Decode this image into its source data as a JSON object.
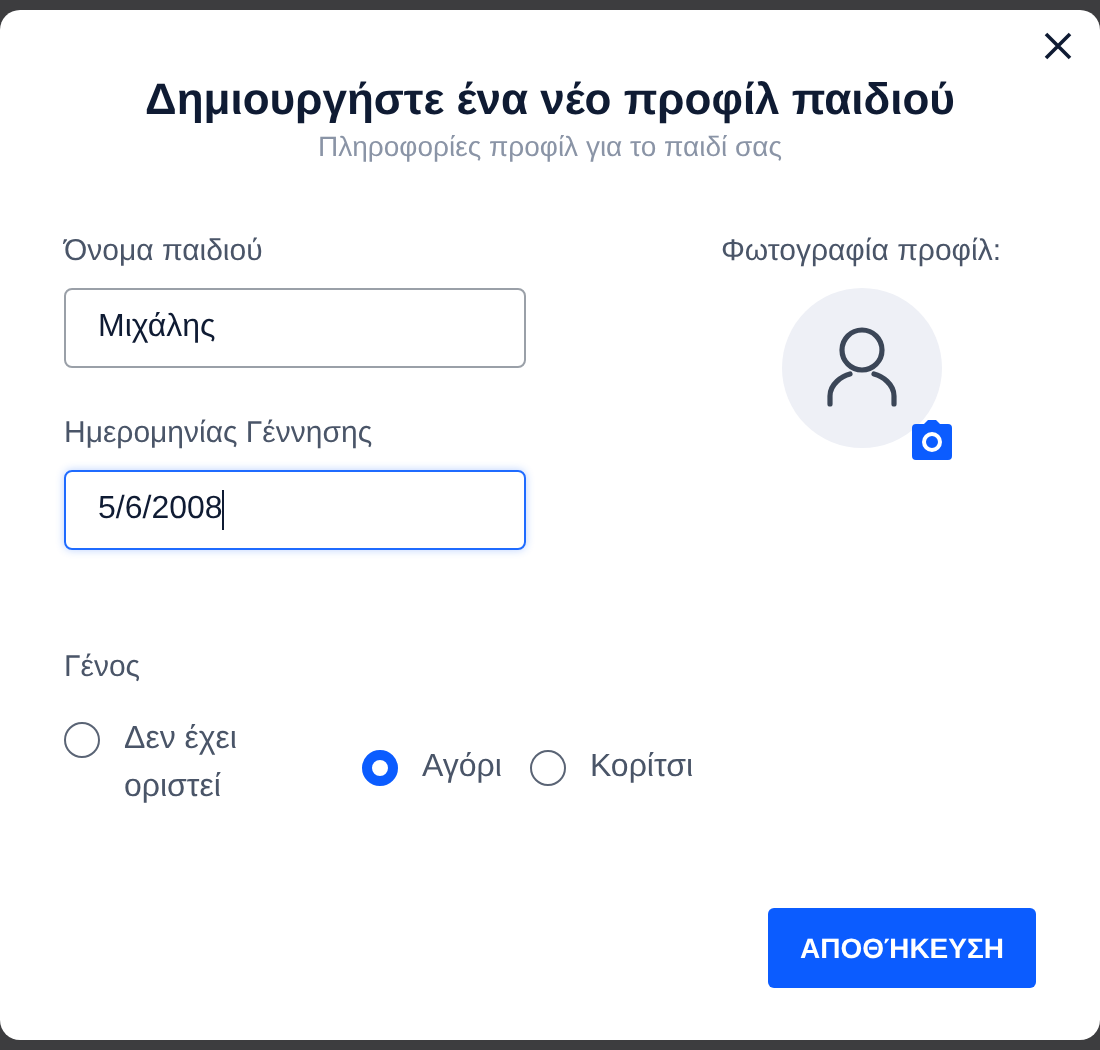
{
  "dialog": {
    "title": "Δημιουργήστε ένα νέο προφίλ παιδιού",
    "subtitle": "Πληροφορίες προφίλ για το παιδί σας"
  },
  "fields": [
    {
      "label": "Όνομα παιδιού",
      "value": "Μιχάλης",
      "focused": false
    },
    {
      "label": "Ημερομηνίας Γέννησης",
      "value": "5/6/2008",
      "focused": true
    }
  ],
  "photo": {
    "label": "Φωτογραφία προφίλ:"
  },
  "gender": {
    "label": "Γένος",
    "options": [
      {
        "label": "Δεν έχει οριστεί",
        "selected": false
      },
      {
        "label": "Αγόρι",
        "selected": true
      },
      {
        "label": "Κορίτσι",
        "selected": false
      }
    ]
  },
  "buttons": [
    {
      "label": "ΑΠΟΘΉΚΕΥΣΗ"
    }
  ]
}
